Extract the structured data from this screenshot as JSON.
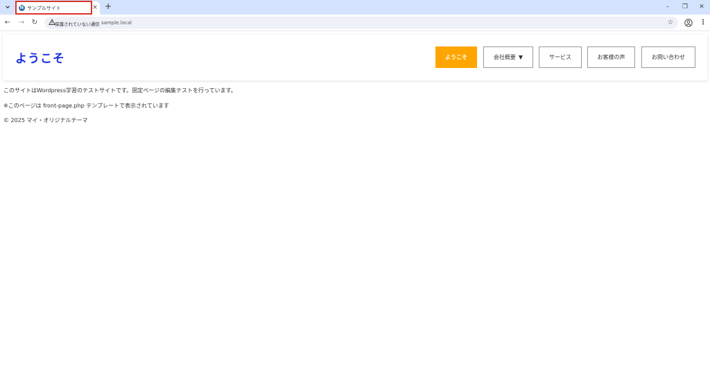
{
  "browser": {
    "tab": {
      "title": "サンプルサイト",
      "favicon": "wordpress-icon",
      "close_icon": "×"
    },
    "new_tab_icon": "+",
    "window_controls": {
      "minimize": "–",
      "restore": "❐",
      "close": "✕"
    },
    "nav": {
      "back": "←",
      "forward": "→",
      "reload": "↻"
    },
    "address_bar": {
      "security_label": "保護されていない通信",
      "url": "sample.local"
    },
    "bookmark_icon": "☆",
    "menu_icon": "⋮"
  },
  "site": {
    "logo": "ようこそ",
    "nav": [
      {
        "label": "ようこそ",
        "active": true
      },
      {
        "label": "会社概要",
        "dropdown": "▼"
      },
      {
        "label": "サービス"
      },
      {
        "label": "お客様の声"
      },
      {
        "label": "お問い合わせ"
      }
    ]
  },
  "content": {
    "paragraph1": "このサイトはWordpress学習のテストサイトです。固定ページの編集テストを行っています。",
    "paragraph2": "※このページは front-page.php テンプレートで表示されています"
  },
  "footer": {
    "copyright": "© 2025 マイ・オリジナルテーマ"
  },
  "colors": {
    "accent": "#ffa500",
    "logo": "#1a2fe0",
    "tabbar": "#d3e3fd",
    "highlight": "#d9352b"
  }
}
